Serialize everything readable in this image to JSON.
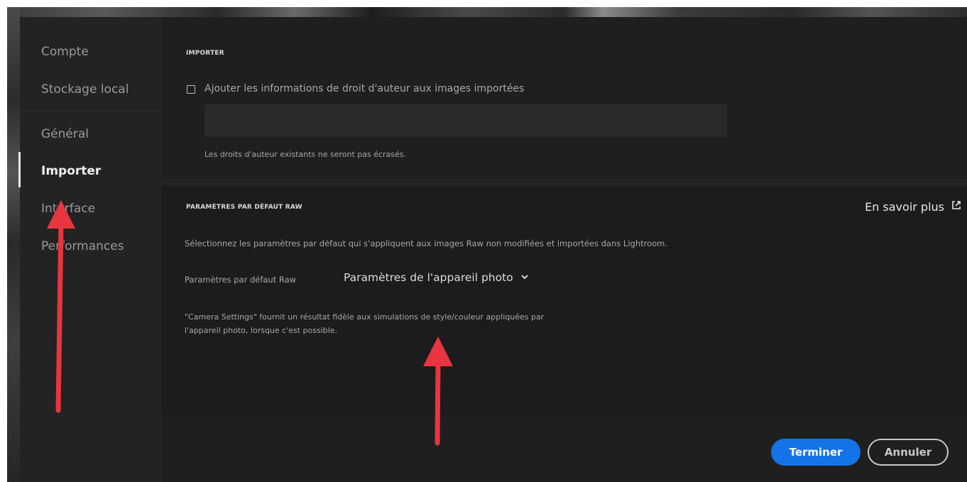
{
  "sidebar": {
    "items": [
      {
        "label": "Compte"
      },
      {
        "label": "Stockage local"
      },
      {
        "label": "Général"
      },
      {
        "label": "Importer"
      },
      {
        "label": "Interface"
      },
      {
        "label": "Performances"
      }
    ],
    "active_item": "Importer"
  },
  "import_section": {
    "title": "IMPORTER",
    "copyright_checkbox_label": "Ajouter les informations de droit d'auteur aux images importées",
    "copyright_checked": false,
    "copyright_value": "",
    "note": "Les droits d'auteur existants ne seront pas écrasés."
  },
  "raw_section": {
    "title": "PARAMÈTRES PAR DÉFAUT RAW",
    "learn_more": "En savoir plus",
    "description": "Sélectionnez les paramètres par défaut qui s'appliquent aux images Raw non modifiées et importées dans Lightroom.",
    "default_label": "Paramètres par défaut Raw",
    "default_value": "Paramètres de l'appareil photo",
    "footnote_line1": "\"Camera Settings\" fournit un résultat fidèle aux simulations de style/couleur appliquées par",
    "footnote_line2": "l'appareil photo, lorsque c'est possible."
  },
  "footer": {
    "done": "Terminer",
    "cancel": "Annuler"
  },
  "colors": {
    "accent": "#1473e6",
    "annotation_arrow": "#e8353f",
    "dialog_bg": "#1f1f1f"
  },
  "icons": [
    "checkbox-icon",
    "external-link-icon",
    "chevron-down-icon",
    "annotation-arrow-icon"
  ]
}
